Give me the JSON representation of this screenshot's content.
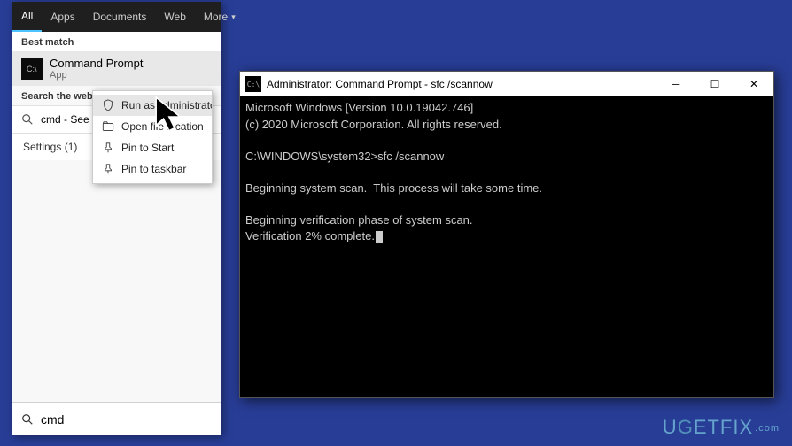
{
  "tabs": {
    "all": "All",
    "apps": "Apps",
    "documents": "Documents",
    "web": "Web",
    "more": "More"
  },
  "start": {
    "best_match": "Best match",
    "result_title": "Command Prompt",
    "result_sub": "App",
    "search_the_web": "Search the web",
    "web_query": "cmd - See web results",
    "settings_label": "Settings (1)",
    "search_value": "cmd"
  },
  "ctx": {
    "run_admin": "Run as administrator",
    "open_loc": "Open file location",
    "pin_start": "Pin to Start",
    "pin_taskbar": "Pin to taskbar"
  },
  "cmd": {
    "title": "Administrator: Command Prompt - sfc  /scannow",
    "line1": "Microsoft Windows [Version 10.0.19042.746]",
    "line2": "(c) 2020 Microsoft Corporation. All rights reserved.",
    "prompt": "C:\\WINDOWS\\system32>sfc /scannow",
    "line3": "Beginning system scan.  This process will take some time.",
    "line4": "Beginning verification phase of system scan.",
    "line5": "Verification 2% complete."
  },
  "watermark": "UGETFIX"
}
